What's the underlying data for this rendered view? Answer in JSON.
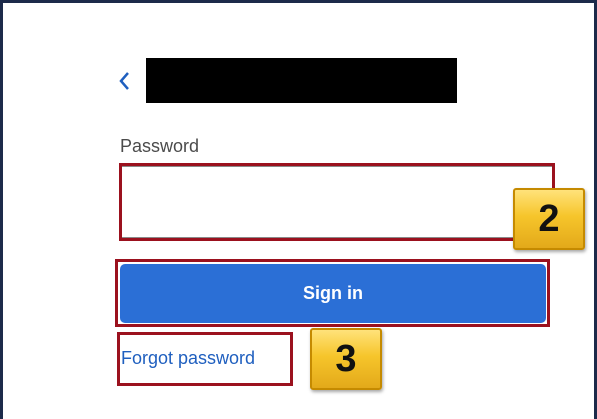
{
  "back_icon": "chevron-left-icon",
  "password": {
    "label": "Password",
    "value": ""
  },
  "sign_in": {
    "label": "Sign in"
  },
  "forgot_password": {
    "label": "Forgot password"
  },
  "annotations": {
    "step_2": "2",
    "step_3": "3"
  },
  "colors": {
    "primary": "#2b6fd6",
    "highlight": "#9b111e",
    "link": "#1f5fbf",
    "badge": "#f6c52b",
    "frame": "#1c2a4a"
  }
}
